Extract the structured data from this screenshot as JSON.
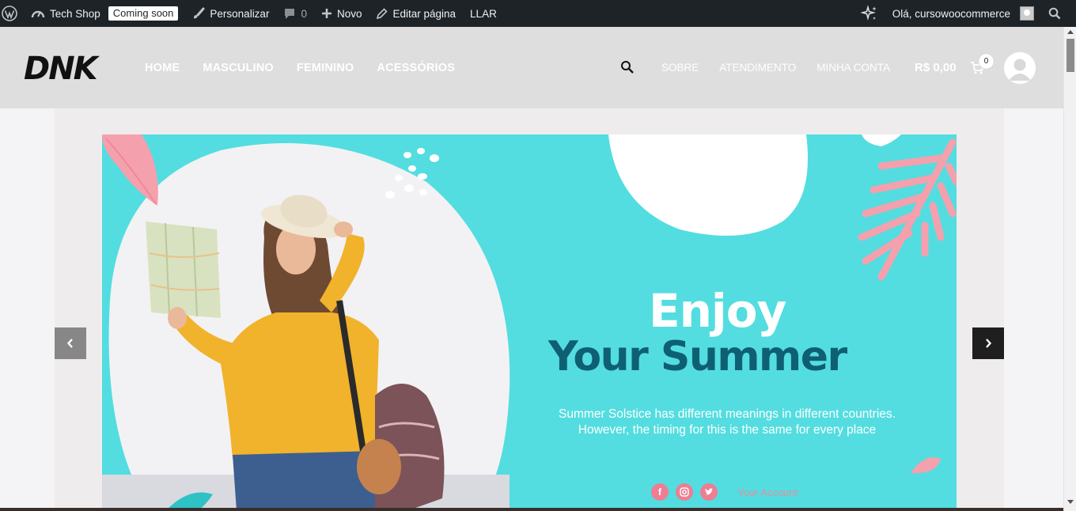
{
  "admin_bar": {
    "site_name": "Tech Shop",
    "coming_soon": "Coming soon",
    "customize": "Personalizar",
    "comments_count": "0",
    "new": "Novo",
    "edit_page": "Editar página",
    "llar": "LLAR",
    "greeting": "Olá, cursowoocommerce"
  },
  "header": {
    "logo_text": "DNK",
    "nav": [
      "HOME",
      "MASCULINO",
      "FEMININO",
      "ACESSÓRIOS"
    ],
    "secondary_nav": [
      "SOBRE",
      "ATENDIMENTO",
      "MINHA CONTA"
    ],
    "cart_total": "R$ 0,00",
    "cart_count": "0"
  },
  "slide": {
    "heading_line1": "Enjoy",
    "heading_line2": "Your Summer",
    "description_line1": "Summer Solstice has different meanings in different countries.",
    "description_line2": "However, the timing for this is the same for every place",
    "social_facebook": "f",
    "social_account": "Your Account"
  },
  "colors": {
    "admin_bar_bg": "#1d2327",
    "header_bg": "#dfdede",
    "slide_bg": "#53dde0",
    "heading_dark": "#0f5f73",
    "pink": "#f5a0ad"
  }
}
